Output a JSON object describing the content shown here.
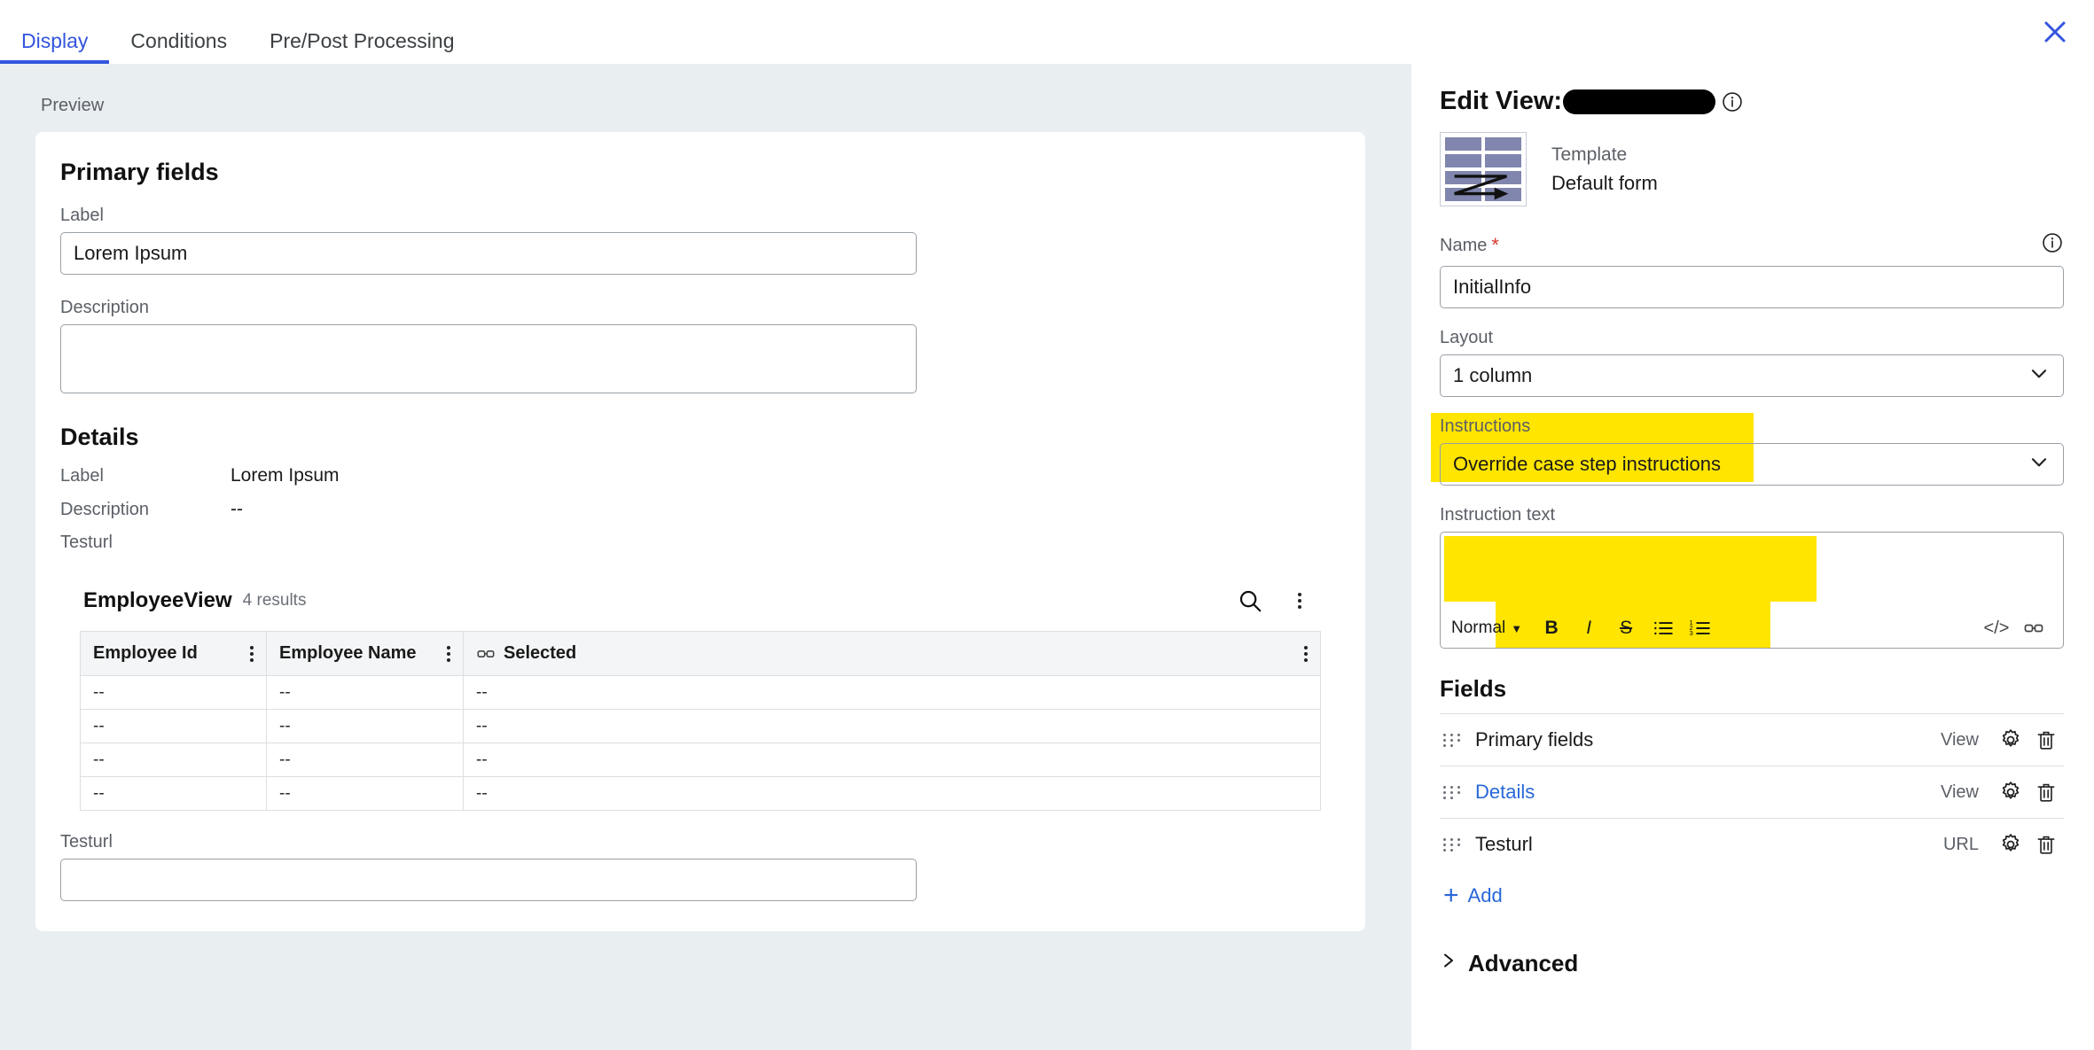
{
  "tabs": [
    {
      "label": "Display",
      "active": true
    },
    {
      "label": "Conditions",
      "active": false
    },
    {
      "label": "Pre/Post Processing",
      "active": false
    }
  ],
  "close_icon": "close-icon",
  "preview": {
    "label": "Preview",
    "primary_fields": {
      "title": "Primary fields",
      "label_caption": "Label",
      "label_value": "Lorem Ipsum",
      "description_caption": "Description",
      "description_value": ""
    },
    "details": {
      "title": "Details",
      "rows": [
        {
          "key": "Label",
          "value": "Lorem Ipsum"
        },
        {
          "key": "Description",
          "value": "--"
        },
        {
          "key": "Testurl",
          "value": ""
        }
      ]
    },
    "list": {
      "title": "EmployeeView",
      "count": "4 results",
      "search_icon": "search-icon",
      "menu_icon": "kebab-menu-icon",
      "columns": [
        {
          "label": "Employee Id",
          "icon": "",
          "menu": true
        },
        {
          "label": "Employee Name",
          "icon": "",
          "menu": true
        },
        {
          "label": "Selected",
          "icon": "link-icon",
          "menu": false
        }
      ],
      "rows": [
        [
          "--",
          "--",
          "--"
        ],
        [
          "--",
          "--",
          "--"
        ],
        [
          "--",
          "--",
          "--"
        ],
        [
          "--",
          "--",
          "--"
        ]
      ]
    },
    "testurl": {
      "caption": "Testurl",
      "value": ""
    }
  },
  "edit": {
    "title": "Edit View:",
    "title_redacted": true,
    "info_icon": "info-icon",
    "template": {
      "caption": "Template",
      "value": "Default form",
      "thumb_icon": "form-template-thumbnail"
    },
    "name": {
      "label": "Name",
      "required": true,
      "value": "InitialInfo",
      "info_icon": "info-icon"
    },
    "layout": {
      "label": "Layout",
      "value": "1 column"
    },
    "instructions": {
      "label": "Instructions",
      "value": "Override case step instructions",
      "highlighted": true
    },
    "instruction_text": {
      "label": "Instruction text",
      "value": "",
      "highlighted": true,
      "toolbar": {
        "style_value": "Normal",
        "bold": "B",
        "italic": "I",
        "strike": "S",
        "bullet_list": "bullet-list-icon",
        "numbered_list": "numbered-list-icon",
        "code": "</>",
        "link": "link-icon"
      }
    },
    "fields": {
      "title": "Fields",
      "rows": [
        {
          "name": "Primary fields",
          "type": "View",
          "link": false
        },
        {
          "name": "Details",
          "type": "View",
          "link": true
        },
        {
          "name": "Testurl",
          "type": "URL",
          "link": false
        }
      ],
      "add_label": "Add"
    },
    "advanced_label": "Advanced"
  },
  "colors": {
    "accent": "#3355dd",
    "link": "#2868d8",
    "highlight": "#ffe500",
    "preview_bg": "#e9eef1",
    "required": "#d13b2e"
  }
}
